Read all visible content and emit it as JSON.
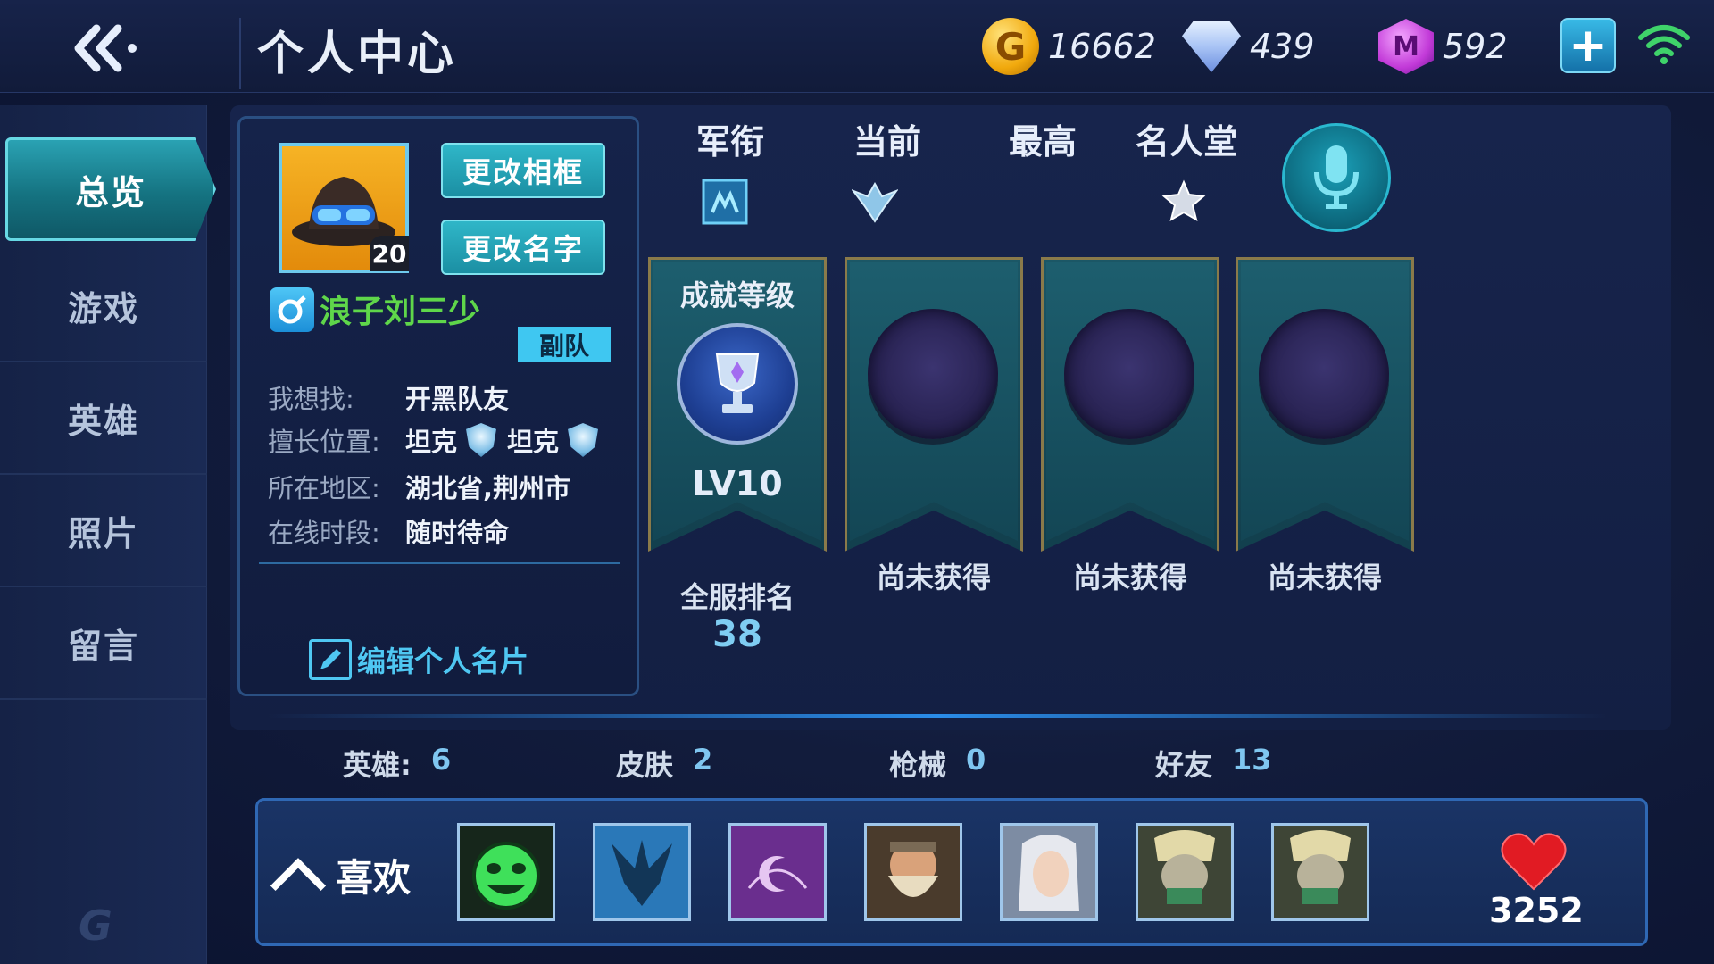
{
  "topbar": {
    "title": "个人中心",
    "back_icon": "double-chevron-left-icon",
    "currencies": [
      {
        "name": "gold",
        "icon": "gold-coin-icon",
        "coin_letter": "G",
        "value": "16662"
      },
      {
        "name": "diamond",
        "icon": "diamond-icon",
        "value": "439"
      },
      {
        "name": "gem",
        "icon": "purple-gem-icon",
        "gem_letter": "M",
        "value": "592"
      }
    ],
    "plus_label": "+",
    "wifi_icon": "wifi-icon"
  },
  "sidebar": {
    "items": [
      {
        "label": "总览",
        "active": true
      },
      {
        "label": "游戏",
        "active": false
      },
      {
        "label": "英雄",
        "active": false
      },
      {
        "label": "照片",
        "active": false
      },
      {
        "label": "留言",
        "active": false
      }
    ],
    "logo_letter": "G"
  },
  "profile": {
    "avatar_level": "20",
    "change_frame_label": "更改相框",
    "change_name_label": "更改名字",
    "nickname": "浪子刘三少",
    "team_tag": "副队",
    "looking_for_key": "我想找:",
    "looking_for_val": "开黑队友",
    "position_key": "擅长位置:",
    "position_1": "坦克",
    "position_2": "坦克",
    "region_key": "所在地区:",
    "region_val": "湖北省,荆州市",
    "online_key": "在线时段:",
    "online_val": "随时待命",
    "edit_card_label": "编辑个人名片"
  },
  "ranks": {
    "military_label": "军衔",
    "current_label": "当前",
    "highest_label": "最高",
    "hall_label": "名人堂"
  },
  "achievements": {
    "title": "成就等级",
    "level": "LV10",
    "not_obtained": [
      "尚未获得",
      "尚未获得",
      "尚未获得"
    ],
    "server_rank_label": "全服排名",
    "server_rank_value": "38"
  },
  "stats": [
    {
      "key": "英雄:",
      "value": "6"
    },
    {
      "key": "皮肤",
      "value": "2"
    },
    {
      "key": "枪械",
      "value": "0"
    },
    {
      "key": "好友",
      "value": "13"
    }
  ],
  "likes": {
    "label": "喜欢",
    "count": "3252",
    "heroes": [
      "green-bomb-hero",
      "blue-winged-emblem",
      "purple-moon-emblem",
      "dwarf-warrior-hero",
      "white-haired-hero",
      "masked-skull-hero",
      "masked-skull-hero"
    ]
  },
  "colors": {
    "accent_cyan": "#2fb6c8",
    "nickname_green": "#5fd64a",
    "value_blue": "#7fc6f0",
    "heart_red": "#e11b23"
  }
}
